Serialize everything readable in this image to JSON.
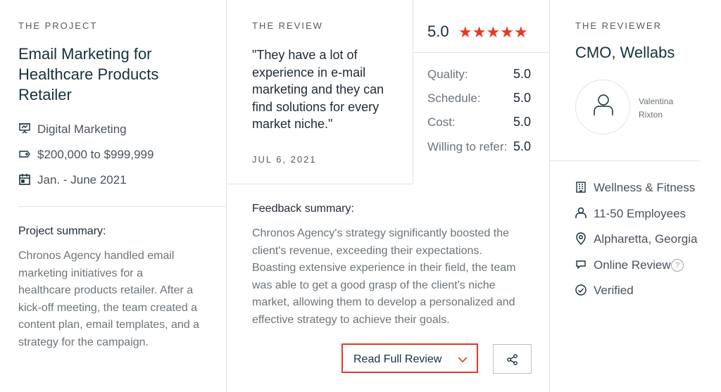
{
  "project": {
    "kicker": "THE PROJECT",
    "title_line1": "Email Marketing for",
    "title_line2": "Healthcare Products",
    "title_line3": "Retailer",
    "service": "Digital Marketing",
    "budget": "$200,000 to $999,999",
    "dates": "Jan. - June 2021",
    "summary_label": "Project summary:",
    "summary_lines": [
      "Chronos Agency handled email",
      "marketing initiatives for a",
      "healthcare products retailer. After a",
      "kick-off meeting, the team created a",
      "content plan, email templates, and a",
      "strategy for the campaign."
    ]
  },
  "review": {
    "kicker": "THE REVIEW",
    "quote_lines": [
      "\"They have a lot of",
      "experience in e-mail",
      "marketing and they can",
      "find solutions for every",
      "market niche.\""
    ],
    "date": "JUL 6, 2021",
    "overall": "5.0",
    "stars": 5,
    "ratings": [
      {
        "label": "Quality:",
        "value": "5.0"
      },
      {
        "label": "Schedule:",
        "value": "5.0"
      },
      {
        "label": "Cost:",
        "value": "5.0"
      },
      {
        "label": "Willing to refer:",
        "value": "5.0"
      }
    ],
    "feedback_label": "Feedback summary:",
    "feedback_lines": [
      "Chronos Agency's strategy significantly boosted the",
      "client's revenue, exceeding their expectations.",
      "Boasting extensive experience in their field, the team",
      "was able to get a good grasp of the client's niche",
      "market, allowing them to develop a personalized and",
      "effective strategy to achieve their goals."
    ],
    "read_full_label": "Read Full Review"
  },
  "reviewer": {
    "kicker": "THE REVIEWER",
    "title": "CMO, Wellabs",
    "name_first": "Valentina",
    "name_last": "Rixton",
    "industry": "Wellness & Fitness",
    "employees": "11-50 Employees",
    "location": "Alpharetta, Georgia",
    "review_type": "Online Review",
    "verified": "Verified"
  },
  "colors": {
    "star": "#e63928",
    "button_border": "#e63928",
    "accent_blue": "#17313b"
  }
}
